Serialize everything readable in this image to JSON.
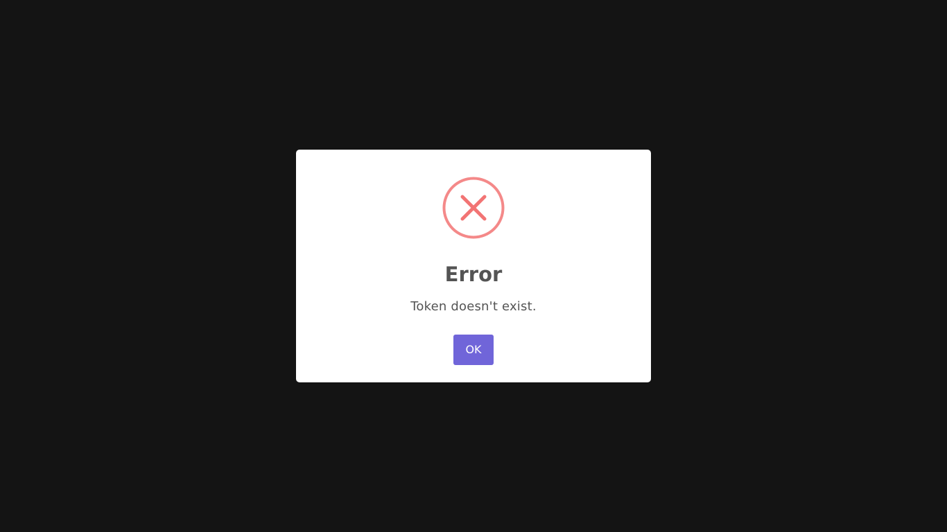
{
  "dialog": {
    "icon": "error-x-circle-icon",
    "title": "Error",
    "message": "Token doesn't exist.",
    "confirm_label": "OK"
  },
  "colors": {
    "backdrop": "#141414",
    "dialog_bg": "#ffffff",
    "error_icon": "#f27474",
    "text": "#545454",
    "button_bg": "#7065d9",
    "button_text": "#ffffff"
  }
}
